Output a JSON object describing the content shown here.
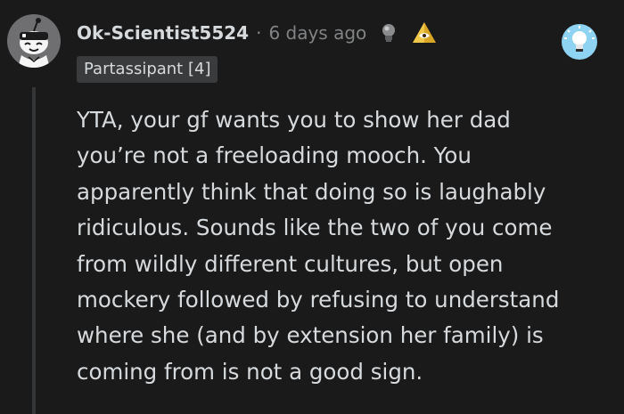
{
  "comment": {
    "username": "Ok-Scientist5524",
    "separator": "·",
    "timestamp": "6 days ago",
    "flair": "Partassipant [4]",
    "body": "YTA, your gf wants you to show her dad\nyou’re not a freeloading mooch. You\napparently think that doing so is laughably\nridiculous. Sounds like the two of you come\nfrom wildly different cultures, but open\nmockery followed by refusing to understand\nwhere she (and by extension her family) is\ncoming from is not a good sign."
  },
  "icons": {
    "avatar": "snoo-avatar",
    "award_1": "silver-bulb-award-icon",
    "award_2": "golden-pyramid-award-icon",
    "corner_award": "blue-lightbulb-award-icon"
  },
  "colors": {
    "background": "#1a1a1b",
    "text": "#d7dadc",
    "muted": "#818384",
    "flair_bg": "#3a3b3c",
    "thread_line": "#343536"
  }
}
